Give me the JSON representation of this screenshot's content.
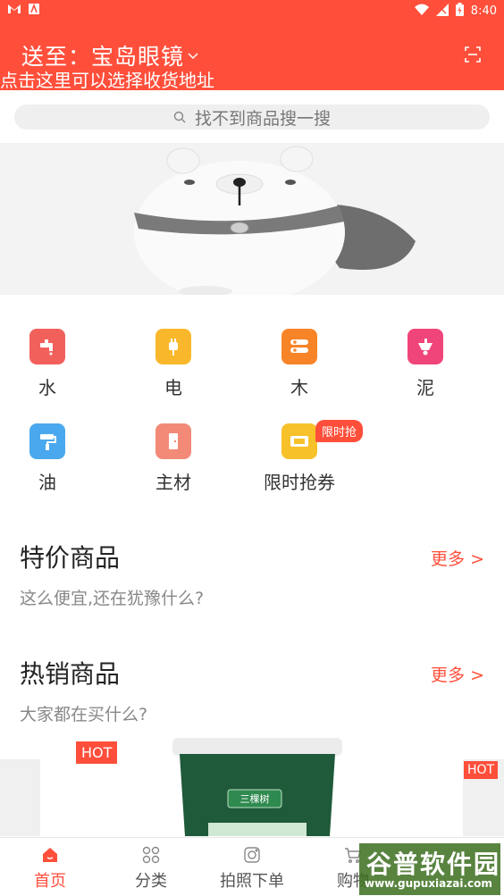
{
  "status_bar": {
    "time": "8:40",
    "left_icons": [
      "gmail-icon",
      "app-icon"
    ],
    "right_icons": [
      "wifi-icon",
      "signal-icon",
      "battery-icon"
    ]
  },
  "header": {
    "address_prefix": "送至：",
    "address": "宝岛眼镜",
    "hint": "点击这里可以选择收货地址",
    "scan_icon": "scan-icon"
  },
  "search": {
    "placeholder": "找不到商品搜一搜"
  },
  "categories": [
    {
      "label": "水",
      "icon": "faucet-icon",
      "color": "#f2605c"
    },
    {
      "label": "电",
      "icon": "plug-icon",
      "color": "#f9b82b"
    },
    {
      "label": "木",
      "icon": "wood-icon",
      "color": "#f78427"
    },
    {
      "label": "泥",
      "icon": "cart-icon",
      "color": "#f0457a"
    },
    {
      "label": "油",
      "icon": "paint-roller-icon",
      "color": "#4aa8ee"
    },
    {
      "label": "主材",
      "icon": "door-icon",
      "color": "#f38a78"
    },
    {
      "label": "限时抢券",
      "icon": "coupon-icon",
      "color": "#f7c12a"
    }
  ],
  "flash_tag": "限时抢",
  "sections": {
    "special": {
      "title": "特价商品",
      "subtitle": "这么便宜,还在犹豫什么?",
      "more": "更多 >"
    },
    "hot": {
      "title": "热销商品",
      "subtitle": "大家都在买什么?",
      "more": "更多 >"
    }
  },
  "products": {
    "hot_badge": "HOT",
    "hot_badge_right": "HOT",
    "brand": "三棵树"
  },
  "tabs": [
    {
      "label": "首页",
      "icon": "home-icon",
      "active": true
    },
    {
      "label": "分类",
      "icon": "category-icon",
      "active": false
    },
    {
      "label": "拍照下单",
      "icon": "camera-icon",
      "active": false
    },
    {
      "label": "购物",
      "icon": "shopping-cart-icon",
      "active": false
    }
  ],
  "watermark": {
    "title": "谷普软件园",
    "url": "www.gupuxiazai.com"
  },
  "colors": {
    "primary": "#ff4f3b",
    "text": "#333333",
    "muted": "#888888"
  }
}
